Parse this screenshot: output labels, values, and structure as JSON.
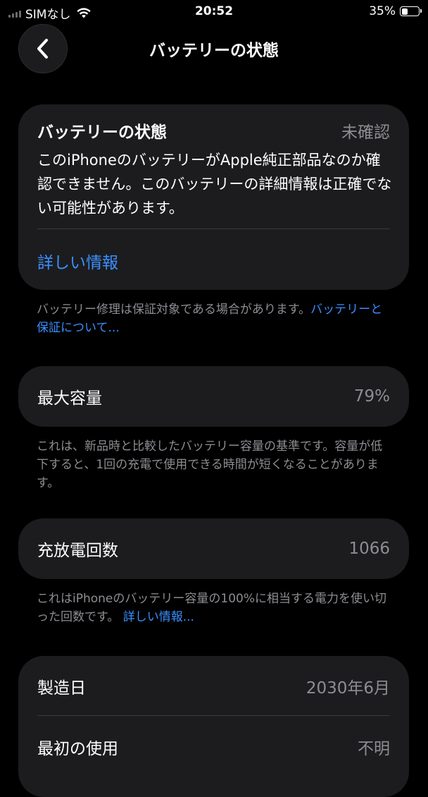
{
  "status_bar": {
    "carrier": "SIMなし",
    "time": "20:52",
    "battery_percent_label": "35%",
    "battery_level": 0.35
  },
  "nav": {
    "back_icon": "chevron-left-icon",
    "title": "バッテリーの状態"
  },
  "health_card": {
    "title": "バッテリーの状態",
    "status": "未確認",
    "description": "このiPhoneのバッテリーがApple純正部品なのか確認できません。このバッテリーの詳細情報は正確でない可能性があります。",
    "link_label": "詳しい情報"
  },
  "warranty_note": {
    "text": "バッテリー修理は保証対象である場合があります。",
    "link": "バッテリーと保証について..."
  },
  "max_capacity": {
    "label": "最大容量",
    "value": "79%",
    "note": "これは、新品時と比較したバッテリー容量の基準です。容量が低下すると、1回の充電で使用できる時間が短くなることがあります。"
  },
  "cycle_count": {
    "label": "充放電回数",
    "value": "1066",
    "note": "これはiPhoneのバッテリー容量の100%に相当する電力を使い切った回数です。",
    "note_link": "詳しい情報..."
  },
  "details": {
    "manufacture_label": "製造日",
    "manufacture_value": "2030年6月",
    "first_use_label": "最初の使用",
    "first_use_value": "不明"
  },
  "colors": {
    "background": "#000000",
    "card": "#1c1c1e",
    "link": "#3a8fff",
    "secondary_text": "#8d8d93"
  }
}
